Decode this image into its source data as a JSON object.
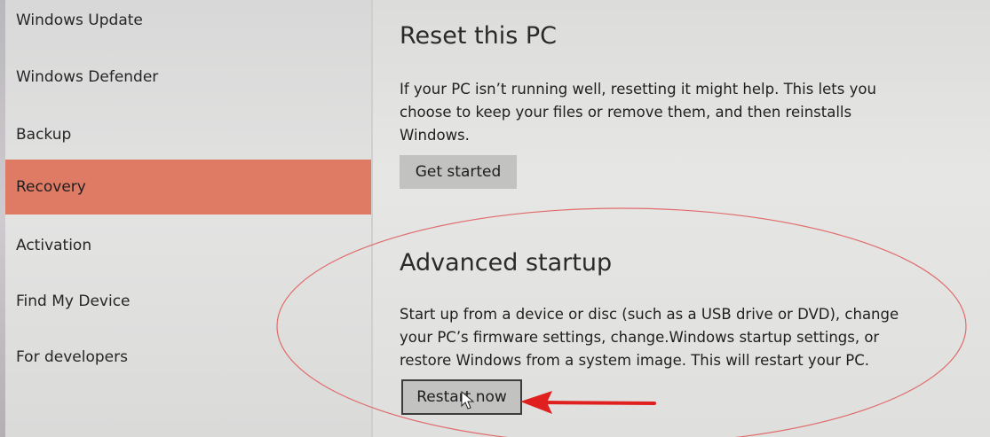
{
  "sidebar": {
    "items": [
      {
        "label": "Windows Update",
        "active": false
      },
      {
        "label": "Windows Defender",
        "active": false
      },
      {
        "label": "Backup",
        "active": false
      },
      {
        "label": "Recovery",
        "active": true
      },
      {
        "label": "Activation",
        "active": false
      },
      {
        "label": "Find My Device",
        "active": false
      },
      {
        "label": "For developers",
        "active": false
      }
    ],
    "active_color": "#df7b65"
  },
  "reset": {
    "heading": "Reset this PC",
    "description": "If your PC isn’t running well, resetting it might help. This lets you choose to keep your files or remove them, and then reinstalls Windows.",
    "button_label": "Get started"
  },
  "advanced": {
    "heading": "Advanced startup",
    "description": "Start up from a device or disc (such as a USB drive or DVD), change your PC’s firmware settings, change.Windows startup settings, or restore Windows from a system image. This will restart your PC.",
    "button_label": "Restart now"
  },
  "annotation": {
    "ellipse_color": "#e06b6b",
    "arrow_color": "#e0201f"
  }
}
